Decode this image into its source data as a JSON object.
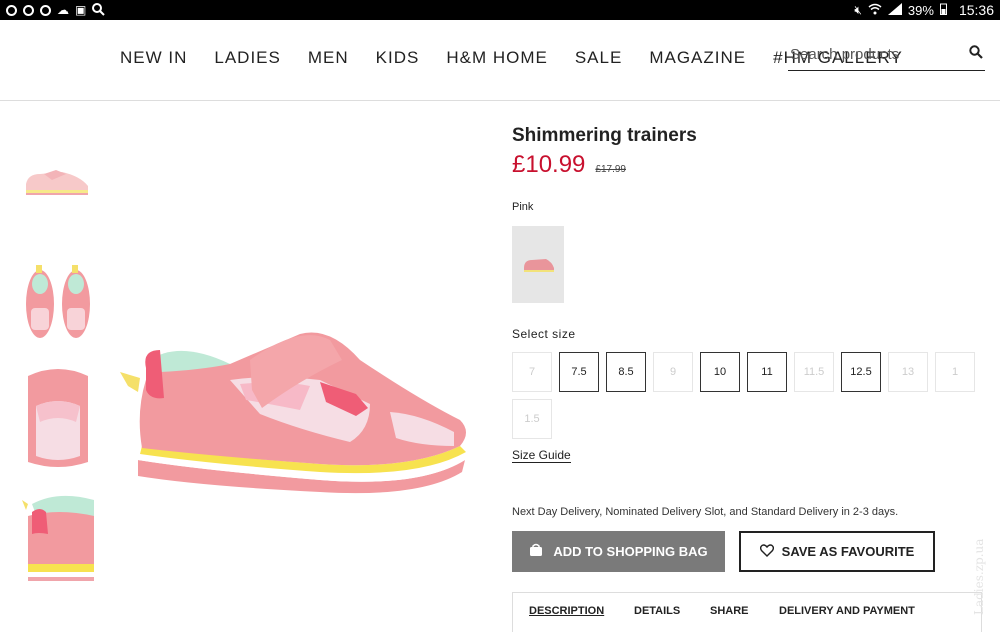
{
  "status_bar": {
    "battery": "39%",
    "time": "15:36",
    "left_icons": [
      "circle-icon",
      "circle-icon",
      "circle-icon",
      "cloud-icon",
      "image-icon",
      "search-icon"
    ],
    "right_icons": [
      "mute-icon",
      "wifi-icon",
      "signal-icon",
      "battery-icon"
    ]
  },
  "nav": {
    "items": [
      {
        "label": "NEW IN"
      },
      {
        "label": "LADIES"
      },
      {
        "label": "MEN"
      },
      {
        "label": "KIDS"
      },
      {
        "label": "H&M HOME"
      },
      {
        "label": "SALE"
      },
      {
        "label": "MAGAZINE"
      },
      {
        "label": "#HM GALLERY"
      }
    ]
  },
  "search": {
    "placeholder": "Search products",
    "value": ""
  },
  "product": {
    "title": "Shimmering trainers",
    "price": "£10.99",
    "old_price": "£17.99",
    "color_label": "Pink"
  },
  "sizes": {
    "label": "Select size",
    "options": [
      {
        "label": "7",
        "available": false
      },
      {
        "label": "7.5",
        "available": true
      },
      {
        "label": "8.5",
        "available": true
      },
      {
        "label": "9",
        "available": false
      },
      {
        "label": "10",
        "available": true
      },
      {
        "label": "11",
        "available": true
      },
      {
        "label": "11.5",
        "available": false
      },
      {
        "label": "12.5",
        "available": true
      },
      {
        "label": "13",
        "available": false
      },
      {
        "label": "1",
        "available": false
      },
      {
        "label": "1.5",
        "available": false
      }
    ],
    "guide_label": "Size Guide"
  },
  "delivery_text": "Next Day Delivery, Nominated Delivery Slot, and Standard Delivery in 2-3 days.",
  "buttons": {
    "add_to_bag": "ADD TO SHOPPING BAG",
    "save_favourite": "SAVE AS FAVOURITE"
  },
  "tabs": [
    {
      "label": "DESCRIPTION",
      "active": true
    },
    {
      "label": "DETAILS",
      "active": false
    },
    {
      "label": "SHARE",
      "active": false
    },
    {
      "label": "DELIVERY AND PAYMENT",
      "active": false
    }
  ],
  "watermark": "Ladies.zp.ua",
  "colors": {
    "price_red": "#c8102e",
    "button_grey": "#7a7a7a",
    "shoe_pink": "#f29a9f"
  }
}
